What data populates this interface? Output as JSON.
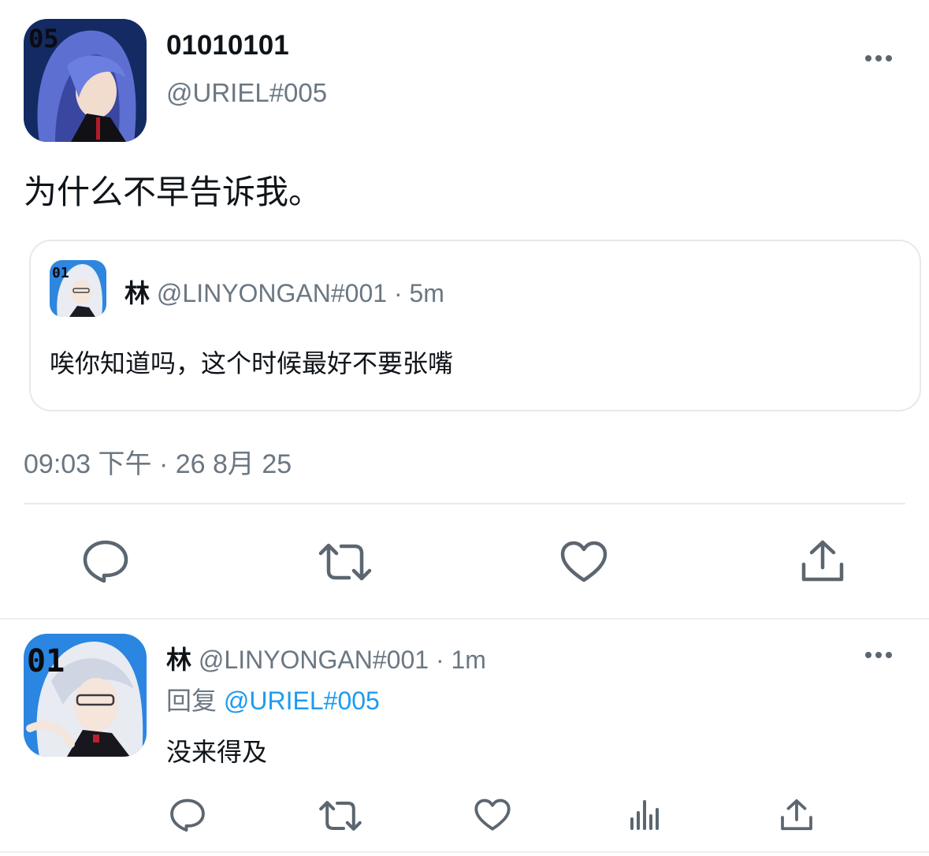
{
  "main_tweet": {
    "display_name": "01010101",
    "handle": "@URIEL#005",
    "text": "为什么不早告诉我。",
    "timestamp": "09:03 下午 · 26 8月 25",
    "avatar_icon": "avatar-dark-blue-hair-character",
    "more_icon": "more-options-icon"
  },
  "quoted_tweet": {
    "display_name": "林",
    "handle": "@LINYONGAN#001",
    "separator": "·",
    "time": "5m",
    "text": "唉你知道吗，这个时候最好不要张嘴",
    "avatar_icon": "avatar-white-hair-glasses-character"
  },
  "main_actions": [
    "reply-icon",
    "retweet-icon",
    "like-icon",
    "share-icon"
  ],
  "reply_tweet": {
    "display_name": "林",
    "handle": "@LINYONGAN#001",
    "separator": "·",
    "time": "1m",
    "reply_prefix": "回复",
    "reply_to": "@URIEL#005",
    "text": "没来得及",
    "avatar_icon": "avatar-white-hair-glasses-character",
    "more_icon": "more-options-icon"
  },
  "reply_actions": [
    "reply-icon",
    "retweet-icon",
    "like-icon",
    "views-icon",
    "share-icon"
  ],
  "colors": {
    "accent": "#1d9bf0",
    "secondary_text": "#6b7782",
    "divider": "#e6e9ec",
    "icon": "#5b6670"
  }
}
